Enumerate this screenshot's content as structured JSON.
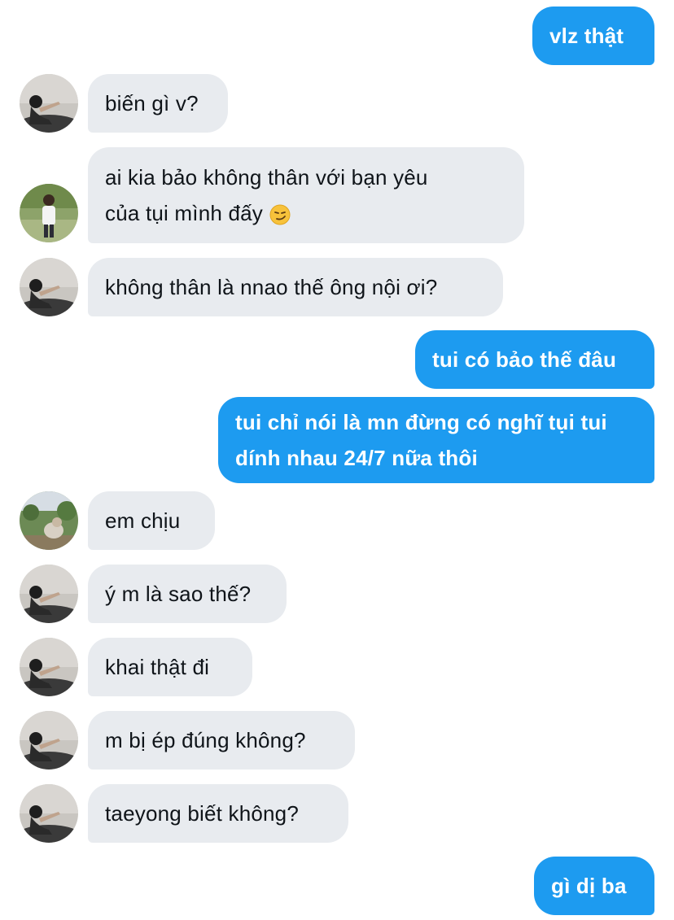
{
  "messages": [
    {
      "id": "m1",
      "side": "out",
      "text": "vlz thật"
    },
    {
      "id": "m2",
      "side": "in",
      "text": "biến gì v?"
    },
    {
      "id": "m3",
      "side": "in",
      "text": "ai kia bảo không thân với bạn yêu\ncủa tụi mình đấy",
      "emoji": "smirk-emoji"
    },
    {
      "id": "m4",
      "side": "in",
      "text": "không thân là nnao thế ông nội ơi?"
    },
    {
      "id": "m5",
      "side": "out",
      "text": "tui có bảo thế đâu"
    },
    {
      "id": "m6",
      "side": "out",
      "text": "tui chỉ nói là mn đừng có nghĩ tụi tui\ndính nhau 24/7 nữa thôi"
    },
    {
      "id": "m7",
      "side": "in",
      "text": "em chịu"
    },
    {
      "id": "m8",
      "side": "in",
      "text": "ý m là sao thế?"
    },
    {
      "id": "m9",
      "side": "in",
      "text": "khai thật đi"
    },
    {
      "id": "m10",
      "side": "in",
      "text": "m bị ép đúng không?"
    },
    {
      "id": "m11",
      "side": "in",
      "text": "taeyong biết không?"
    },
    {
      "id": "m12",
      "side": "out",
      "text": "gì dị ba"
    }
  ],
  "colors": {
    "outgoing_bubble": "#1d9bf0",
    "incoming_bubble": "#e8ebef",
    "outgoing_text": "#ffffff",
    "incoming_text": "#0f1419"
  }
}
